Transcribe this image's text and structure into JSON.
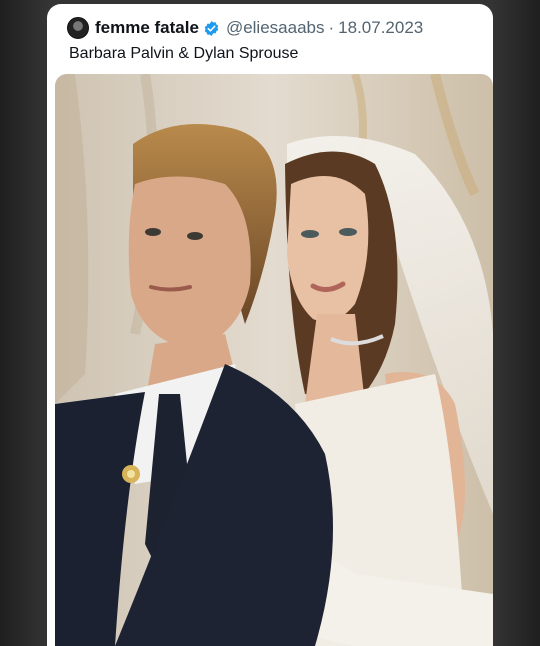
{
  "post": {
    "author_name": "femme fatale",
    "handle": "@eliesaaabs",
    "separator": "·",
    "date": "18.07.2023",
    "text": "Barbara Palvin & Dylan Sprouse"
  },
  "icons": {
    "avatar": "profile-avatar",
    "verified": "verified-badge-icon"
  },
  "colors": {
    "verified_blue": "#1d9bf0",
    "name_text": "#0f1419",
    "secondary_text": "#536471"
  }
}
